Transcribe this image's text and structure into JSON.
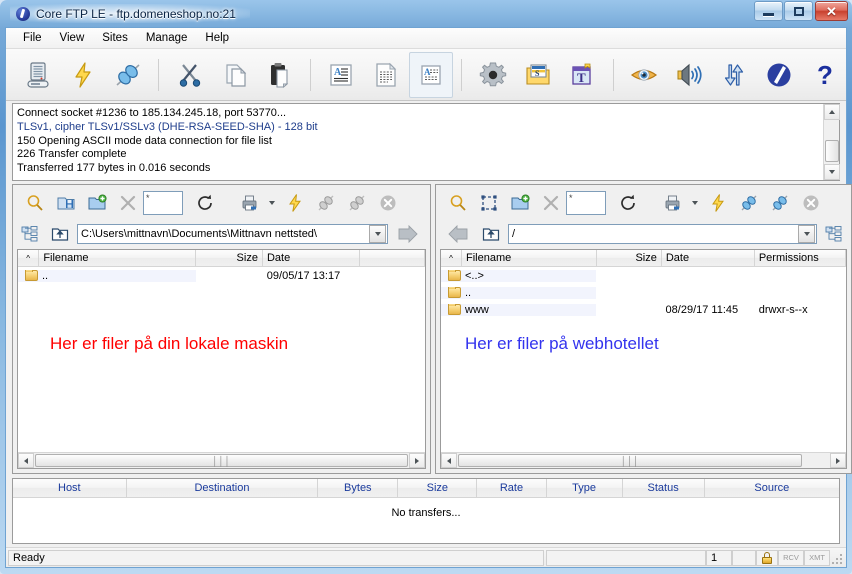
{
  "window": {
    "title": "Core FTP LE - ftp.domeneshop.no:21",
    "app_icon": "core-ftp-logo",
    "buttons": {
      "minimize": "minimize",
      "maximize": "maximize",
      "close": "close"
    }
  },
  "menu": {
    "items": [
      {
        "label": "File",
        "name": "menu-file"
      },
      {
        "label": "View",
        "name": "menu-view"
      },
      {
        "label": "Sites",
        "name": "menu-sites"
      },
      {
        "label": "Manage",
        "name": "menu-manage"
      },
      {
        "label": "Help",
        "name": "menu-help"
      }
    ]
  },
  "toolbar": {
    "buttons": [
      {
        "icon": "server-icon",
        "title": "Site Manager"
      },
      {
        "icon": "lightning-icon",
        "title": "Quick Connect"
      },
      {
        "icon": "connect-plug-icon",
        "title": "Connect"
      },
      {
        "sep": true
      },
      {
        "icon": "scissors-icon",
        "title": "Cut"
      },
      {
        "icon": "copy-pages-icon",
        "title": "Copy"
      },
      {
        "icon": "clipboard-paste-icon",
        "title": "Paste"
      },
      {
        "sep": true
      },
      {
        "icon": "ascii-mode-icon",
        "title": "ASCII transfer mode"
      },
      {
        "icon": "binary-mode-icon",
        "title": "Binary transfer mode"
      },
      {
        "icon": "auto-mode-icon",
        "title": "Auto transfer mode",
        "pressed": true
      },
      {
        "sep": true
      },
      {
        "icon": "gear-icon",
        "title": "Options"
      },
      {
        "icon": "folder-s-icon",
        "title": "Site settings"
      },
      {
        "icon": "t-box-icon",
        "title": "Templates"
      },
      {
        "sep": true
      },
      {
        "icon": "eye-icon",
        "title": "View"
      },
      {
        "icon": "speaker-icon",
        "title": "Sounds"
      },
      {
        "icon": "transfer-arrows-icon",
        "title": "Transfer queue"
      },
      {
        "icon": "blue-sphere-icon",
        "title": "About Core FTP"
      },
      {
        "icon": "question-mark-icon",
        "title": "Help"
      }
    ]
  },
  "log": {
    "lines": [
      {
        "text": "Connect socket #1236 to 185.134.245.18, port 53770...",
        "color": "black"
      },
      {
        "text": "TLSv1, cipher TLSv1/SSLv3 (DHE-RSA-SEED-SHA) - 128 bit",
        "color": "blue"
      },
      {
        "text": "150 Opening ASCII mode data connection for file list",
        "color": "black"
      },
      {
        "text": "226 Transfer complete",
        "color": "black"
      },
      {
        "text": "Transferred 177 bytes in 0.016 seconds",
        "color": "black"
      }
    ]
  },
  "local_pane": {
    "name": "local-file-pane",
    "toolbar": [
      {
        "icon": "search-icon",
        "title": "Find"
      },
      {
        "icon": "save-folder-icon",
        "title": "Save"
      },
      {
        "icon": "new-folder-icon",
        "title": "New folder"
      },
      {
        "icon": "delete-x-icon",
        "title": "Delete"
      }
    ],
    "filter_value": "*",
    "toolbar2": [
      {
        "icon": "refresh-icon",
        "title": "Refresh"
      },
      {
        "icon": "print-icon",
        "title": "Print"
      },
      {
        "icon": "chevron-down-icon",
        "title": "More"
      },
      {
        "icon": "lightning-icon",
        "title": "Quick action"
      },
      {
        "icon": "connect-plug-icon",
        "title": "Connect"
      },
      {
        "icon": "disconnect-plug-icon",
        "title": "Disconnect"
      },
      {
        "icon": "close-circle-icon",
        "title": "Stop"
      }
    ],
    "path": "C:\\Users\\mittnavn\\Documents\\Mittnavn nettsted\\",
    "columns": [
      {
        "label": "Filename",
        "width": 165
      },
      {
        "label": "Size",
        "width": 70,
        "align": "right"
      },
      {
        "label": "Date",
        "width": 102
      },
      {
        "label": "",
        "width": 68
      }
    ],
    "rows": [
      {
        "icon": "folder-icon",
        "filename": "..",
        "size": "",
        "date": "09/05/17  13:17",
        "extra": ""
      }
    ],
    "annotation": {
      "text": "Her er filer på din lokale maskin",
      "color": "#ff0000"
    }
  },
  "remote_pane": {
    "name": "remote-file-pane",
    "toolbar": [
      {
        "icon": "search-icon",
        "title": "Find"
      },
      {
        "icon": "select-box-icon",
        "title": "Select"
      },
      {
        "icon": "new-folder-icon",
        "title": "New folder"
      },
      {
        "icon": "delete-x-icon",
        "title": "Delete"
      }
    ],
    "filter_value": "*",
    "toolbar2": [
      {
        "icon": "refresh-icon",
        "title": "Refresh"
      },
      {
        "icon": "print-icon",
        "title": "Print"
      },
      {
        "icon": "chevron-down-icon",
        "title": "More"
      },
      {
        "icon": "lightning-icon",
        "title": "Quick action"
      },
      {
        "icon": "connect-plug-icon",
        "title": "Connect"
      },
      {
        "icon": "disconnect-plug-icon",
        "title": "Disconnect"
      },
      {
        "icon": "close-circle-icon",
        "title": "Stop"
      }
    ],
    "path": "/",
    "columns": [
      {
        "label": "Filename",
        "width": 145
      },
      {
        "label": "Size",
        "width": 70,
        "align": "right"
      },
      {
        "label": "Date",
        "width": 100
      },
      {
        "label": "Permissions",
        "width": 98
      }
    ],
    "rows": [
      {
        "icon": "folder-icon",
        "filename": "<..>",
        "size": "",
        "date": "",
        "perm": ""
      },
      {
        "icon": "folder-icon",
        "filename": "..",
        "size": "",
        "date": "",
        "perm": ""
      },
      {
        "icon": "folder-icon",
        "filename": "www",
        "size": "",
        "date": "08/29/17  11:45",
        "perm": "drwxr-s--x"
      }
    ],
    "annotation": {
      "text": "Her er filer på webhotellet",
      "color": "#3333ee"
    }
  },
  "queue": {
    "columns": [
      {
        "label": "Host",
        "width": 115
      },
      {
        "label": "Destination",
        "width": 194
      },
      {
        "label": "Bytes",
        "width": 81
      },
      {
        "label": "Size",
        "width": 80
      },
      {
        "label": "Rate",
        "width": 70
      },
      {
        "label": "Type",
        "width": 77
      },
      {
        "label": "Status",
        "width": 83
      },
      {
        "label": "Source",
        "width": 136
      }
    ],
    "empty_text": "No transfers..."
  },
  "statusbar": {
    "message": "Ready",
    "progress": "",
    "count": "1",
    "spacer": "",
    "lock_icon": "lock-icon",
    "rcv_label": "RCV",
    "xmt_label": "XMT"
  },
  "colors": {
    "title_gradient_top": "#9ac5ea",
    "title_gradient_mid": "#5b96cf",
    "log_blue": "#1f3e8c",
    "queue_header_text": "#1a3a9c",
    "annot_red": "#ff0000",
    "annot_blue": "#3333ee"
  }
}
